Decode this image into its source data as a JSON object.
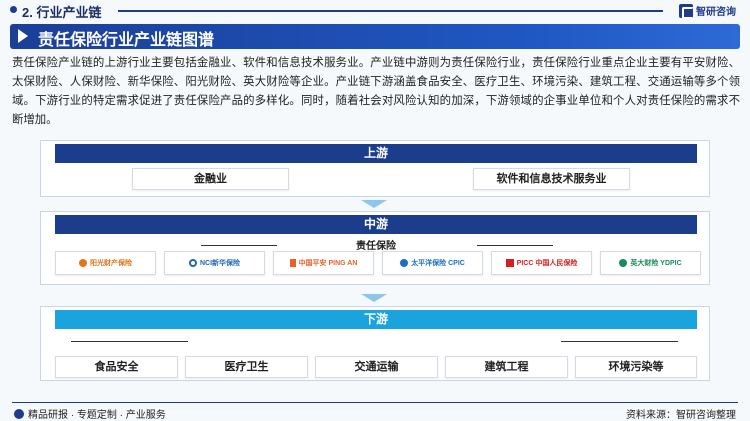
{
  "header": {
    "section_title": "2. 行业产业链",
    "logo_text": "智研咨询"
  },
  "banner": {
    "title": "责任保险行业产业链图谱"
  },
  "description": "责任保险产业链的上游行业主要包括金融业、软件和信息技术服务业。产业链中游则为责任保险行业，责任保险行业重点企业主要有平安财险、太保财险、人保财险、新华保险、阳光财险、英大财险等企业。产业链下游涵盖食品安全、医疗卫生、环境污染、建筑工程、交通运输等多个领域。下游行业的特定需求促进了责任保险产品的多样化。同时，随着社会对风险认知的加深，下游领域的企事业单位和个人对责任保险的需求不断增加。",
  "upstream": {
    "title": "上游",
    "items": [
      "金融业",
      "软件和信息技术服务业"
    ]
  },
  "midstream": {
    "title": "中游",
    "subtitle": "责任保险",
    "companies": [
      {
        "text": "阳光财产保险",
        "color": "#e0751a",
        "icon": "sunshine-logo-icon"
      },
      {
        "text": "NCI新华保险",
        "color": "#1f66b8",
        "icon": "nci-logo-icon"
      },
      {
        "text": "中国平安 PING AN",
        "color": "#e8612c",
        "icon": "pingan-logo-icon"
      },
      {
        "text": "太平洋保险 CPIC",
        "color": "#1a6fc4",
        "icon": "cpic-logo-icon"
      },
      {
        "text": "PICC 中国人民保险",
        "color": "#d6201f",
        "icon": "picc-logo-icon"
      },
      {
        "text": "英大财险 YDPIC",
        "color": "#1b8a5a",
        "icon": "ydpic-logo-icon"
      }
    ]
  },
  "downstream": {
    "title": "下游",
    "items": [
      "食品安全",
      "医疗卫生",
      "交通运输",
      "建筑工程",
      "环境污染等"
    ]
  },
  "footer": {
    "left_text": "精品研报 · 专题定制 · 产业服务",
    "source": "资料来源：智研咨询整理"
  },
  "colors": {
    "navy": "#1c3c8c",
    "cyan": "#1aa3dc",
    "banner": "#1f57c2"
  }
}
